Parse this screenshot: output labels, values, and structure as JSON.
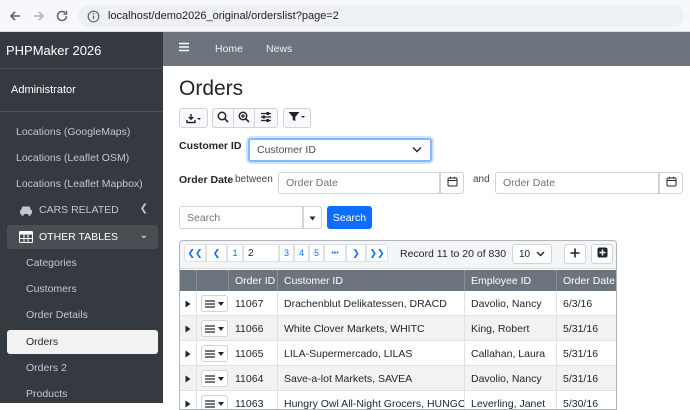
{
  "browser": {
    "url": "localhost/demo2026_original/orderslist?page=2"
  },
  "sidebar": {
    "brand": "PHPMaker 2026",
    "user": "Administrator",
    "items": [
      {
        "label": "Locations (GoogleMaps)"
      },
      {
        "label": "Locations (Leaflet OSM)"
      },
      {
        "label": "Locations (Leaflet Mapbox)"
      },
      {
        "label": "CARS RELATED"
      },
      {
        "label": "OTHER TABLES"
      },
      {
        "label": "Categories"
      },
      {
        "label": "Customers"
      },
      {
        "label": "Order Details"
      },
      {
        "label": "Orders"
      },
      {
        "label": "Orders 2"
      },
      {
        "label": "Products"
      }
    ]
  },
  "topnav": {
    "home": "Home",
    "news": "News"
  },
  "main": {
    "title": "Orders",
    "customer_label": "Customer ID",
    "customer_select": "Customer ID",
    "orderdate_label": "Order Date",
    "between": "between",
    "and": "and",
    "date_placeholder1": "Order Date",
    "date_placeholder2": "Order Date",
    "search_placeholder": "Search",
    "search_button": "Search"
  },
  "pager": {
    "pages": [
      "1",
      "2",
      "3",
      "4",
      "5"
    ],
    "current": "2",
    "ellipsis": "•••",
    "record_info": "Record 11 to 20 of 830",
    "page_size": "10"
  },
  "table": {
    "columns": [
      "Order ID",
      "Customer ID",
      "Employee ID",
      "Order Date"
    ],
    "rows": [
      [
        "11067",
        "Drachenblut Delikatessen, DRACD",
        "Davolio, Nancy",
        "6/3/16"
      ],
      [
        "11066",
        "White Clover Markets, WHITC",
        "King, Robert",
        "5/31/16"
      ],
      [
        "11065",
        "LILA-Supermercado, LILAS",
        "Callahan, Laura",
        "5/31/16"
      ],
      [
        "11064",
        "Save-a-lot Markets, SAVEA",
        "Davolio, Nancy",
        "5/31/16"
      ],
      [
        "11063",
        "Hungry Owl All-Night Grocers, HUNGO",
        "Leverling, Janet",
        "5/30/16"
      ]
    ]
  }
}
